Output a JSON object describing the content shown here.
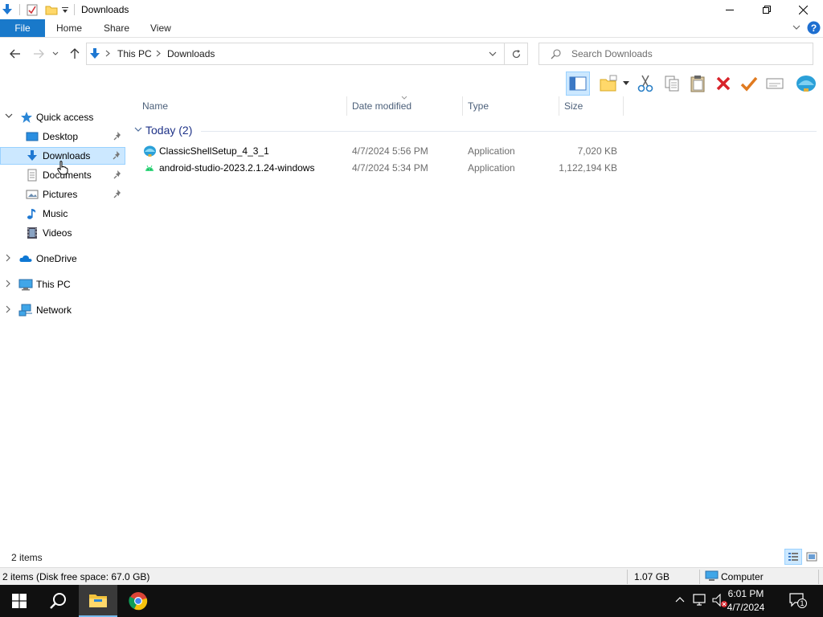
{
  "window": {
    "title": "Downloads"
  },
  "ribbon": {
    "tabs": [
      "File",
      "Home",
      "Share",
      "View"
    ]
  },
  "address": {
    "crumbs": [
      "This PC",
      "Downloads"
    ],
    "search_placeholder": "Search Downloads"
  },
  "nav": {
    "quick_access": "Quick access",
    "items": [
      "Desktop",
      "Downloads",
      "Documents",
      "Pictures",
      "Music",
      "Videos"
    ],
    "roots": [
      "OneDrive",
      "This PC",
      "Network"
    ],
    "selected": "Downloads"
  },
  "columns": [
    "Name",
    "Date modified",
    "Type",
    "Size"
  ],
  "group": {
    "label": "Today (2)"
  },
  "files": [
    {
      "name": "ClassicShellSetup_4_3_1",
      "date": "4/7/2024 5:56 PM",
      "type": "Application",
      "size": "7,020 KB",
      "icon": "classic-shell-icon"
    },
    {
      "name": "android-studio-2023.2.1.24-windows",
      "date": "4/7/2024 5:34 PM",
      "type": "Application",
      "size": "1,122,194 KB",
      "icon": "android-icon"
    }
  ],
  "status": {
    "count": "2 items",
    "details": "2 items (Disk free space: 67.0 GB)",
    "total_size": "1.07 GB",
    "location": "Computer"
  },
  "taskbar": {
    "time": "6:01 PM",
    "date": "4/7/2024",
    "notifications": "1"
  },
  "colors": {
    "accent": "#1979ca",
    "selection": "#cce8ff",
    "group_text": "#1e3287"
  }
}
